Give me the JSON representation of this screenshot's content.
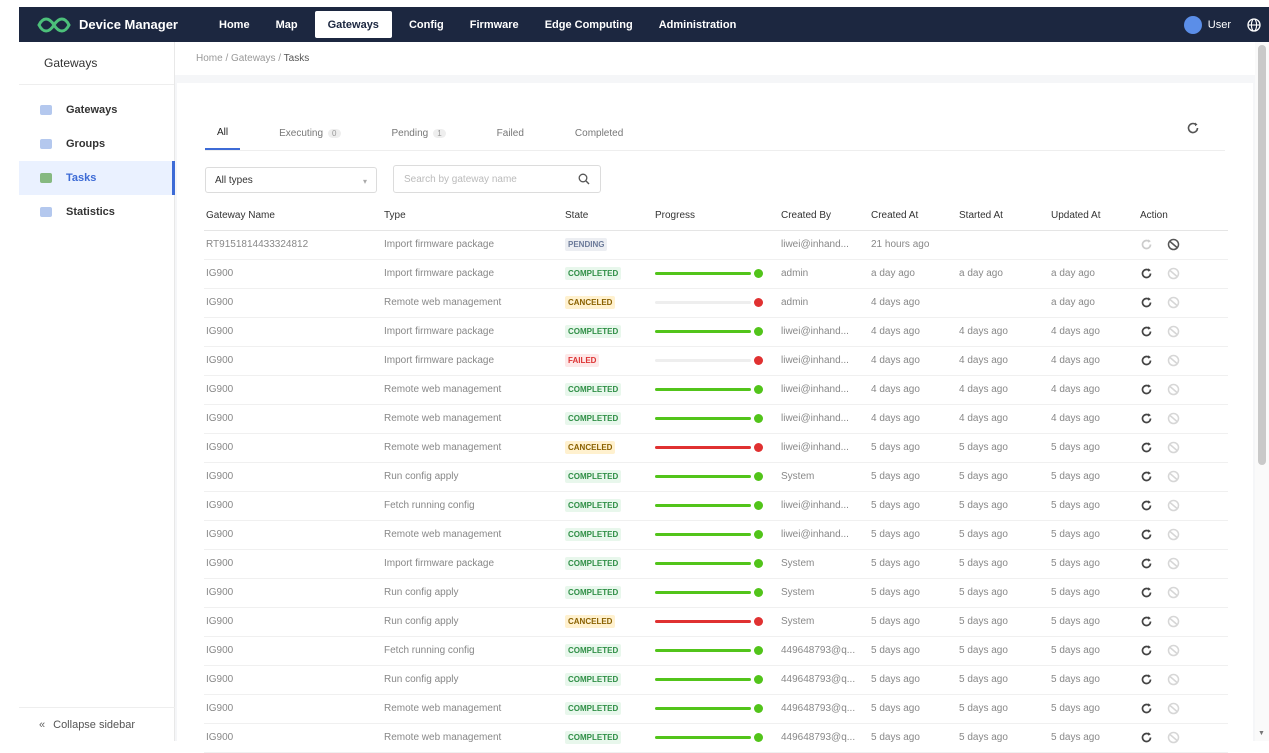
{
  "app": {
    "title": "Device Manager",
    "user": "User"
  },
  "nav": [
    {
      "label": "Home",
      "active": false
    },
    {
      "label": "Map",
      "active": false
    },
    {
      "label": "Gateways",
      "active": true
    },
    {
      "label": "Config",
      "active": false
    },
    {
      "label": "Firmware",
      "active": false
    },
    {
      "label": "Edge Computing",
      "active": false
    },
    {
      "label": "Administration",
      "active": false
    }
  ],
  "sidebar": {
    "title": "Gateways",
    "items": [
      {
        "label": "Gateways",
        "icon": "gateway-icon",
        "active": false
      },
      {
        "label": "Groups",
        "icon": "groups-icon",
        "active": false
      },
      {
        "label": "Tasks",
        "icon": "tasks-icon",
        "active": true
      },
      {
        "label": "Statistics",
        "icon": "statistics-icon",
        "active": false
      }
    ],
    "collapse_label": "Collapse sidebar"
  },
  "breadcrumb": {
    "home": "Home",
    "section": "Gateways",
    "current": "Tasks",
    "sep": "/"
  },
  "tabs": [
    {
      "label": "All",
      "count": "",
      "active": true
    },
    {
      "label": "Executing",
      "count": "0",
      "active": false
    },
    {
      "label": "Pending",
      "count": "1",
      "active": false
    },
    {
      "label": "Failed",
      "count": "",
      "active": false
    },
    {
      "label": "Completed",
      "count": "",
      "active": false
    }
  ],
  "filters": {
    "type_value": "All types",
    "search_placeholder": "Search by gateway name"
  },
  "columns": [
    "Gateway Name",
    "Type",
    "State",
    "Progress",
    "Created By",
    "Created At",
    "Started At",
    "Updated At",
    "Action"
  ],
  "rows": [
    {
      "gateway": "RT9151814433324812",
      "type": "Import firmware package",
      "state": "PENDING",
      "progress": null,
      "result": "",
      "created_by": "liwei@inhand...",
      "created_at": "21 hours ago",
      "started_at": "",
      "updated_at": "",
      "retry_enabled": false,
      "cancel_enabled": true
    },
    {
      "gateway": "IG900",
      "type": "Import firmware package",
      "state": "COMPLETED",
      "progress": 1.0,
      "result": "ok",
      "created_by": "admin",
      "created_at": "a day ago",
      "started_at": "a day ago",
      "updated_at": "a day ago",
      "retry_enabled": true,
      "cancel_enabled": false
    },
    {
      "gateway": "IG900",
      "type": "Remote web management",
      "state": "CANCELED",
      "progress": 0.0,
      "result": "err",
      "created_by": "admin",
      "created_at": "4 days ago",
      "started_at": "",
      "updated_at": "a day ago",
      "retry_enabled": true,
      "cancel_enabled": false
    },
    {
      "gateway": "IG900",
      "type": "Import firmware package",
      "state": "COMPLETED",
      "progress": 1.0,
      "result": "ok",
      "created_by": "liwei@inhand...",
      "created_at": "4 days ago",
      "started_at": "4 days ago",
      "updated_at": "4 days ago",
      "retry_enabled": true,
      "cancel_enabled": false
    },
    {
      "gateway": "IG900",
      "type": "Import firmware package",
      "state": "FAILED",
      "progress": 0.0,
      "result": "err",
      "created_by": "liwei@inhand...",
      "created_at": "4 days ago",
      "started_at": "4 days ago",
      "updated_at": "4 days ago",
      "retry_enabled": true,
      "cancel_enabled": false
    },
    {
      "gateway": "IG900",
      "type": "Remote web management",
      "state": "COMPLETED",
      "progress": 1.0,
      "result": "ok",
      "created_by": "liwei@inhand...",
      "created_at": "4 days ago",
      "started_at": "4 days ago",
      "updated_at": "4 days ago",
      "retry_enabled": true,
      "cancel_enabled": false
    },
    {
      "gateway": "IG900",
      "type": "Remote web management",
      "state": "COMPLETED",
      "progress": 1.0,
      "result": "ok",
      "created_by": "liwei@inhand...",
      "created_at": "4 days ago",
      "started_at": "4 days ago",
      "updated_at": "4 days ago",
      "retry_enabled": true,
      "cancel_enabled": false
    },
    {
      "gateway": "IG900",
      "type": "Remote web management",
      "state": "CANCELED",
      "progress": 1.0,
      "result": "err",
      "created_by": "liwei@inhand...",
      "created_at": "5 days ago",
      "started_at": "5 days ago",
      "updated_at": "5 days ago",
      "retry_enabled": true,
      "cancel_enabled": false
    },
    {
      "gateway": "IG900",
      "type": "Run config apply",
      "state": "COMPLETED",
      "progress": 1.0,
      "result": "ok",
      "created_by": "System",
      "created_at": "5 days ago",
      "started_at": "5 days ago",
      "updated_at": "5 days ago",
      "retry_enabled": true,
      "cancel_enabled": false
    },
    {
      "gateway": "IG900",
      "type": "Fetch running config",
      "state": "COMPLETED",
      "progress": 1.0,
      "result": "ok",
      "created_by": "liwei@inhand...",
      "created_at": "5 days ago",
      "started_at": "5 days ago",
      "updated_at": "5 days ago",
      "retry_enabled": true,
      "cancel_enabled": false
    },
    {
      "gateway": "IG900",
      "type": "Remote web management",
      "state": "COMPLETED",
      "progress": 1.0,
      "result": "ok",
      "created_by": "liwei@inhand...",
      "created_at": "5 days ago",
      "started_at": "5 days ago",
      "updated_at": "5 days ago",
      "retry_enabled": true,
      "cancel_enabled": false
    },
    {
      "gateway": "IG900",
      "type": "Import firmware package",
      "state": "COMPLETED",
      "progress": 1.0,
      "result": "ok",
      "created_by": "System",
      "created_at": "5 days ago",
      "started_at": "5 days ago",
      "updated_at": "5 days ago",
      "retry_enabled": true,
      "cancel_enabled": false
    },
    {
      "gateway": "IG900",
      "type": "Run config apply",
      "state": "COMPLETED",
      "progress": 1.0,
      "result": "ok",
      "created_by": "System",
      "created_at": "5 days ago",
      "started_at": "5 days ago",
      "updated_at": "5 days ago",
      "retry_enabled": true,
      "cancel_enabled": false
    },
    {
      "gateway": "IG900",
      "type": "Run config apply",
      "state": "CANCELED",
      "progress": 1.0,
      "result": "err",
      "created_by": "System",
      "created_at": "5 days ago",
      "started_at": "5 days ago",
      "updated_at": "5 days ago",
      "retry_enabled": true,
      "cancel_enabled": false
    },
    {
      "gateway": "IG900",
      "type": "Fetch running config",
      "state": "COMPLETED",
      "progress": 1.0,
      "result": "ok",
      "created_by": "449648793@q...",
      "created_at": "5 days ago",
      "started_at": "5 days ago",
      "updated_at": "5 days ago",
      "retry_enabled": true,
      "cancel_enabled": false
    },
    {
      "gateway": "IG900",
      "type": "Run config apply",
      "state": "COMPLETED",
      "progress": 1.0,
      "result": "ok",
      "created_by": "449648793@q...",
      "created_at": "5 days ago",
      "started_at": "5 days ago",
      "updated_at": "5 days ago",
      "retry_enabled": true,
      "cancel_enabled": false
    },
    {
      "gateway": "IG900",
      "type": "Remote web management",
      "state": "COMPLETED",
      "progress": 1.0,
      "result": "ok",
      "created_by": "449648793@q...",
      "created_at": "5 days ago",
      "started_at": "5 days ago",
      "updated_at": "5 days ago",
      "retry_enabled": true,
      "cancel_enabled": false
    },
    {
      "gateway": "IG900",
      "type": "Remote web management",
      "state": "COMPLETED",
      "progress": 1.0,
      "result": "ok",
      "created_by": "449648793@q...",
      "created_at": "5 days ago",
      "started_at": "5 days ago",
      "updated_at": "5 days ago",
      "retry_enabled": true,
      "cancel_enabled": false
    }
  ],
  "colors": {
    "topbar": "#1c2740",
    "accent": "#3d6bd6",
    "success": "#52c41a",
    "error": "#e03131"
  }
}
